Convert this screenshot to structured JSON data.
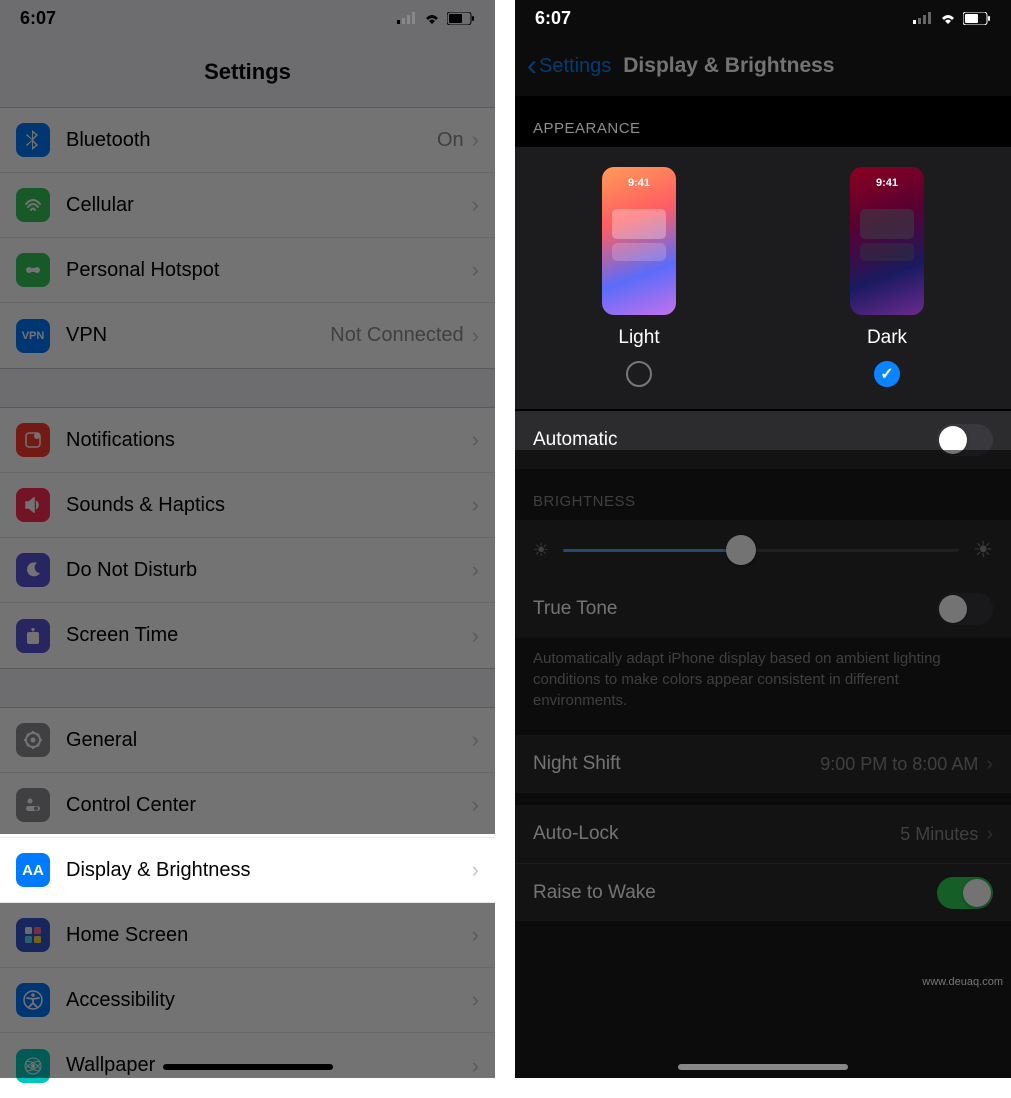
{
  "status": {
    "time": "6:07"
  },
  "left": {
    "title": "Settings",
    "groups": [
      [
        {
          "icon": "bluetooth",
          "color": "#007aff",
          "label": "Bluetooth",
          "value": "On"
        },
        {
          "icon": "cellular",
          "color": "#34c759",
          "label": "Cellular",
          "value": ""
        },
        {
          "icon": "hotspot",
          "color": "#34c759",
          "label": "Personal Hotspot",
          "value": ""
        },
        {
          "icon": "vpn",
          "color": "#007aff",
          "label": "VPN",
          "value": "Not Connected"
        }
      ],
      [
        {
          "icon": "notifications",
          "color": "#ff3b30",
          "label": "Notifications",
          "value": ""
        },
        {
          "icon": "sounds",
          "color": "#ff2d55",
          "label": "Sounds & Haptics",
          "value": ""
        },
        {
          "icon": "dnd",
          "color": "#5856d6",
          "label": "Do Not Disturb",
          "value": ""
        },
        {
          "icon": "screentime",
          "color": "#5856d6",
          "label": "Screen Time",
          "value": ""
        }
      ],
      [
        {
          "icon": "general",
          "color": "#8e8e93",
          "label": "General",
          "value": ""
        },
        {
          "icon": "control",
          "color": "#8e8e93",
          "label": "Control Center",
          "value": ""
        },
        {
          "icon": "display",
          "color": "#007aff",
          "label": "Display & Brightness",
          "value": "",
          "highlight": true
        },
        {
          "icon": "home",
          "color": "#3355cc",
          "label": "Home Screen",
          "value": ""
        },
        {
          "icon": "accessibility",
          "color": "#007aff",
          "label": "Accessibility",
          "value": ""
        },
        {
          "icon": "wallpaper",
          "color": "#00c7be",
          "label": "Wallpaper",
          "value": ""
        }
      ]
    ]
  },
  "right": {
    "back": "Settings",
    "title": "Display & Brightness",
    "appearance_header": "APPEARANCE",
    "mini_time": "9:41",
    "light_label": "Light",
    "dark_label": "Dark",
    "selected": "dark",
    "automatic_label": "Automatic",
    "automatic_on": false,
    "brightness_header": "BRIGHTNESS",
    "brightness_value": 45,
    "truetone_label": "True Tone",
    "truetone_on": false,
    "truetone_desc": "Automatically adapt iPhone display based on ambient lighting conditions to make colors appear consistent in different environments.",
    "nightshift_label": "Night Shift",
    "nightshift_value": "9:00 PM to 8:00 AM",
    "autolock_label": "Auto-Lock",
    "autolock_value": "5 Minutes",
    "raise_label": "Raise to Wake",
    "raise_on": true
  },
  "watermark": "www.deuaq.com"
}
